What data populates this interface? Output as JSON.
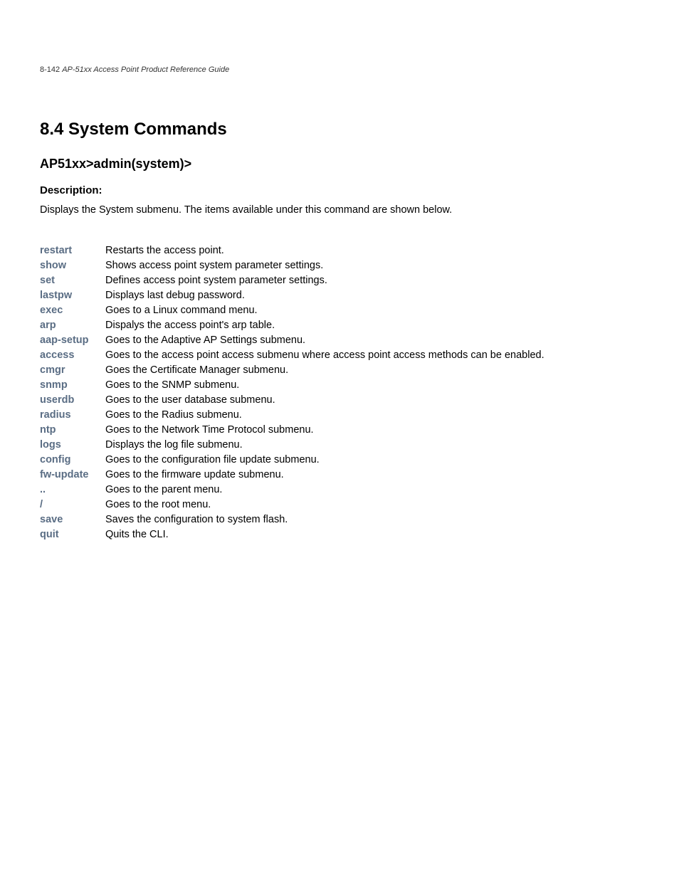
{
  "header": {
    "page_number": "8-142",
    "doc_title": "AP-51xx Access Point Product Reference Guide"
  },
  "section": {
    "heading": "8.4  System Commands",
    "prompt": "AP51xx>admin(system)>",
    "desc_label": "Description:",
    "desc_body": "Displays the System submenu. The items available under this command are shown below."
  },
  "commands": [
    {
      "cmd": "restart",
      "desc": "Restarts the access point."
    },
    {
      "cmd": "show",
      "desc": "Shows access point system parameter settings."
    },
    {
      "cmd": "set",
      "desc": "Defines access point system parameter settings."
    },
    {
      "cmd": "lastpw",
      "desc": "Displays last debug password."
    },
    {
      "cmd": "exec",
      "desc": "Goes to a Linux command menu."
    },
    {
      "cmd": "arp",
      "desc": "Dispalys the access point's arp table."
    },
    {
      "cmd": "aap-setup",
      "desc": "Goes to the Adaptive AP Settings submenu."
    },
    {
      "cmd": "access",
      "desc": "Goes to the access point access submenu where access point access methods can be enabled."
    },
    {
      "cmd": "cmgr",
      "desc": "Goes the Certificate Manager submenu."
    },
    {
      "cmd": "snmp",
      "desc": "Goes to the SNMP submenu."
    },
    {
      "cmd": "userdb",
      "desc": "Goes to the user database submenu."
    },
    {
      "cmd": "radius",
      "desc": "Goes to the Radius submenu."
    },
    {
      "cmd": "ntp",
      "desc": "Goes to the Network Time Protocol submenu."
    },
    {
      "cmd": "logs",
      "desc": "Displays the log file submenu."
    },
    {
      "cmd": "config",
      "desc": "Goes to the configuration file update submenu."
    },
    {
      "cmd": "fw-update",
      "desc": "Goes to the firmware update submenu."
    },
    {
      "cmd": "..",
      "desc": "Goes to the parent menu."
    },
    {
      "cmd": "/",
      "desc": "Goes to the root menu."
    },
    {
      "cmd": "save",
      "desc": "Saves the configuration to system flash."
    },
    {
      "cmd": "quit",
      "desc": "Quits the CLI."
    }
  ]
}
